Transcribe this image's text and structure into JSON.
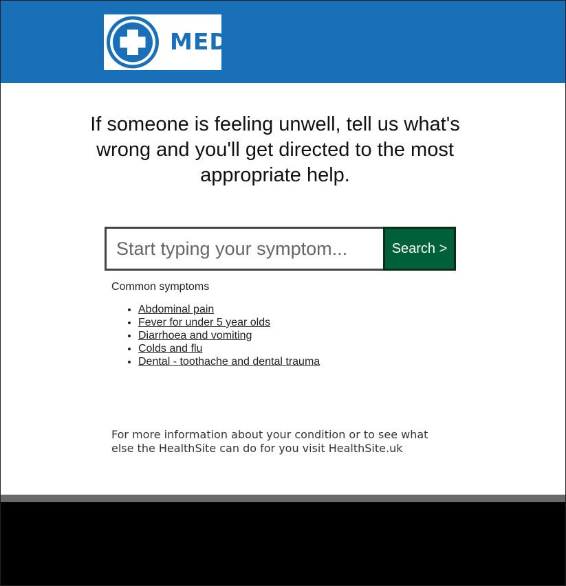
{
  "header": {
    "logo_text": "MED",
    "logo_icon": "medical-cross-icon",
    "brand_color": "#1a70b8"
  },
  "main": {
    "headline": "If someone is feeling unwell, tell us what's wrong and you'll get directed to the most appropriate help.",
    "search": {
      "placeholder": "Start typing your symptom...",
      "value": "",
      "button_label": "Search >"
    },
    "common_symptoms": {
      "title": "Common symptoms",
      "items": [
        "Abdominal pain",
        "Fever for under 5 year olds",
        "Diarrhoea and vomiting",
        "Colds and flu",
        "Dental - toothache and dental trauma"
      ]
    },
    "info_text": "For more information about your condition or to see what else the HealthSite can do for you visit HealthSite.uk"
  },
  "colors": {
    "button_bg": "#00603a",
    "footer_bar": "#6a6a6a",
    "footer": "#000000"
  }
}
